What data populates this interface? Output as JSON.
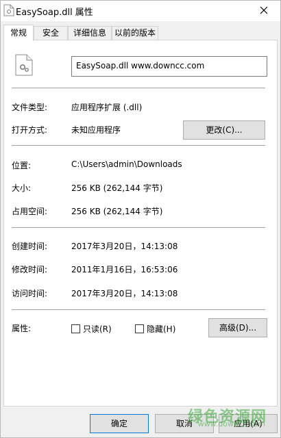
{
  "window": {
    "title": "EasySoap.dll 属性"
  },
  "tabs": [
    "常规",
    "安全",
    "详细信息",
    "以前的版本"
  ],
  "file": {
    "name": "EasySoap.dll     www.downcc.com"
  },
  "info": {
    "type_label": "文件类型:",
    "type_value": "应用程序扩展 (.dll)",
    "openwith_label": "打开方式:",
    "openwith_value": "未知应用程序",
    "change_button": "更改(C)...",
    "location_label": "位置:",
    "location_value": "C:\\Users\\admin\\Downloads",
    "size_label": "大小:",
    "size_value": "256 KB (262,144 字节)",
    "disksize_label": "占用空间:",
    "disksize_value": "256 KB (262,144 字节)",
    "created_label": "创建时间:",
    "created_value": "2017年3月20日，14:13:08",
    "modified_label": "修改时间:",
    "modified_value": "2011年1月16日，16:53:06",
    "accessed_label": "访问时间:",
    "accessed_value": "2017年3月20日，14:13:08",
    "attributes_label": "属性:",
    "readonly_label": "只读(R)",
    "hidden_label": "隐藏(H)",
    "advanced_button": "高级(D)..."
  },
  "footer": {
    "ok": "确定",
    "cancel": "取消",
    "apply": "应用(A)"
  },
  "watermark": {
    "text": "绿色资源网",
    "sub": "www.downcc.com"
  }
}
